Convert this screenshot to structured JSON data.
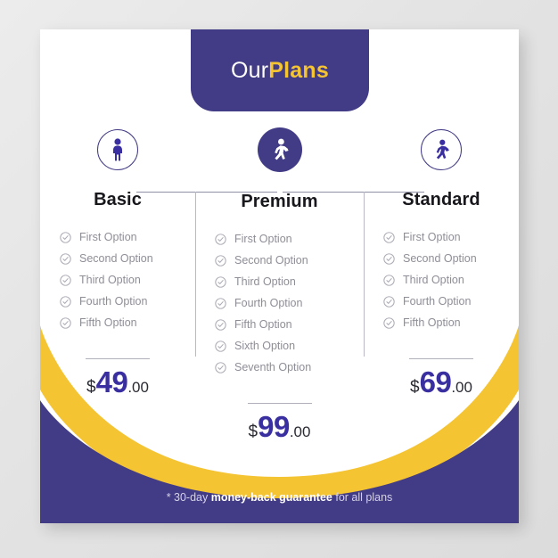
{
  "theme": {
    "purple": "#423B85",
    "purple_deep": "#3a2fa0",
    "yellow": "#F5C433",
    "card_bg": "#ffffff",
    "page_bg": "#e6e6e6",
    "muted_text": "#8e8e97"
  },
  "header": {
    "title_light": "Our",
    "title_strong": "Plans"
  },
  "plans": [
    {
      "id": "basic",
      "name": "Basic",
      "icon": "person-standing-icon",
      "featured": false,
      "features": [
        "First Option",
        "Second Option",
        "Third Option",
        "Fourth Option",
        "Fifth Option"
      ],
      "price": {
        "currency": "$",
        "amount": "49",
        "decimals": ".00"
      }
    },
    {
      "id": "premium",
      "name": "Premium",
      "icon": "person-walking-icon",
      "featured": true,
      "features": [
        "First Option",
        "Second Option",
        "Third Option",
        "Fourth Option",
        "Fifth Option",
        "Sixth Option",
        "Seventh Option"
      ],
      "price": {
        "currency": "$",
        "amount": "99",
        "decimals": ".00"
      }
    },
    {
      "id": "standard",
      "name": "Standard",
      "icon": "person-walking-icon",
      "featured": false,
      "features": [
        "First Option",
        "Second Option",
        "Third Option",
        "Fourth Option",
        "Fifth Option"
      ],
      "price": {
        "currency": "$",
        "amount": "69",
        "decimals": ".00"
      }
    }
  ],
  "footer": {
    "prefix": "* 30-day ",
    "emphasis": "money-back guarantee",
    "suffix": " for all plans"
  }
}
